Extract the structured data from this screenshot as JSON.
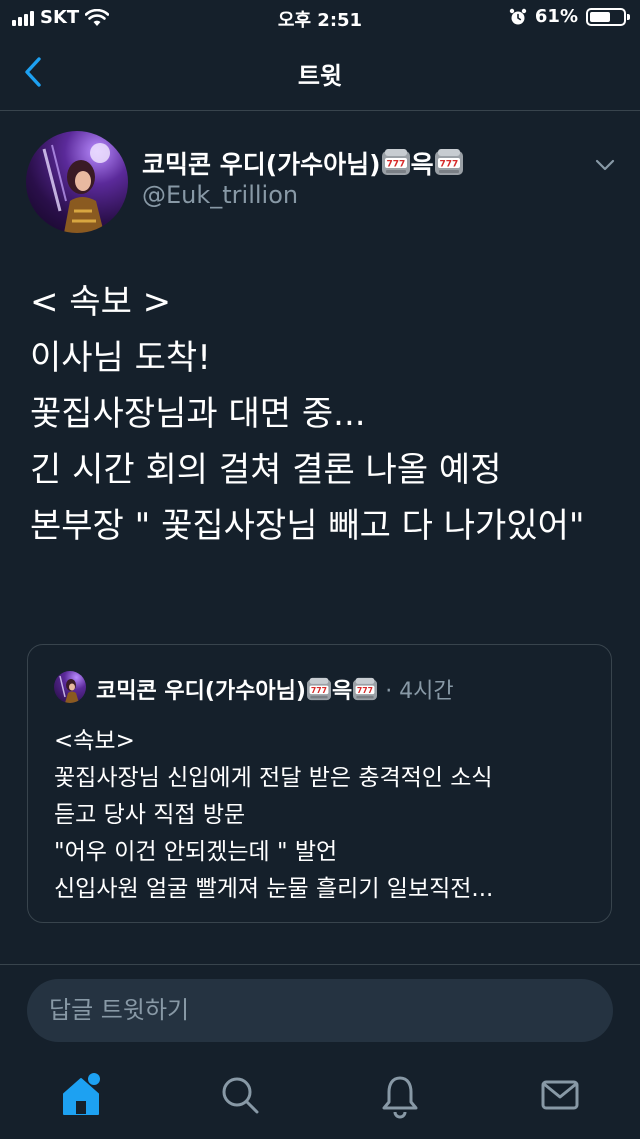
{
  "status_bar": {
    "carrier": "SKT",
    "time": "오후 2:51",
    "battery": "61%",
    "battery_level": 0.61
  },
  "nav": {
    "title": "트윗"
  },
  "tweet": {
    "author_name": "코믹콘 우디(가수아님)",
    "author_name_mid": "윽",
    "handle": "@Euk_trillion",
    "text": "< 속보 >\n이사님 도착!\n꽃집사장님과 대면 중...\n긴 시간 회의 걸쳐 결론 나올 예정\n본부장 \" 꽃집사장님 빼고 다 나가있어\""
  },
  "quote": {
    "author_name": "코믹콘 우디(가수아님)",
    "author_name_mid": "윽",
    "time": "· 4시간",
    "text": "<속보>\n꽃집사장님 신입에게 전달 받은 충격적인 소식\n듣고 당사 직접 방문\n\"어우 이건 안되겠는데 \" 발언\n신입사원 얼굴 빨게져 눈물 흘리기 일보직전..."
  },
  "reply": {
    "placeholder": "답글 트윗하기"
  },
  "tabs": [
    "home-icon",
    "search-icon",
    "notifications-icon",
    "messages-icon"
  ],
  "colors": {
    "background": "#15202b",
    "accent": "#1da1f2",
    "secondary_text": "#8899a6",
    "border": "#38444d"
  }
}
